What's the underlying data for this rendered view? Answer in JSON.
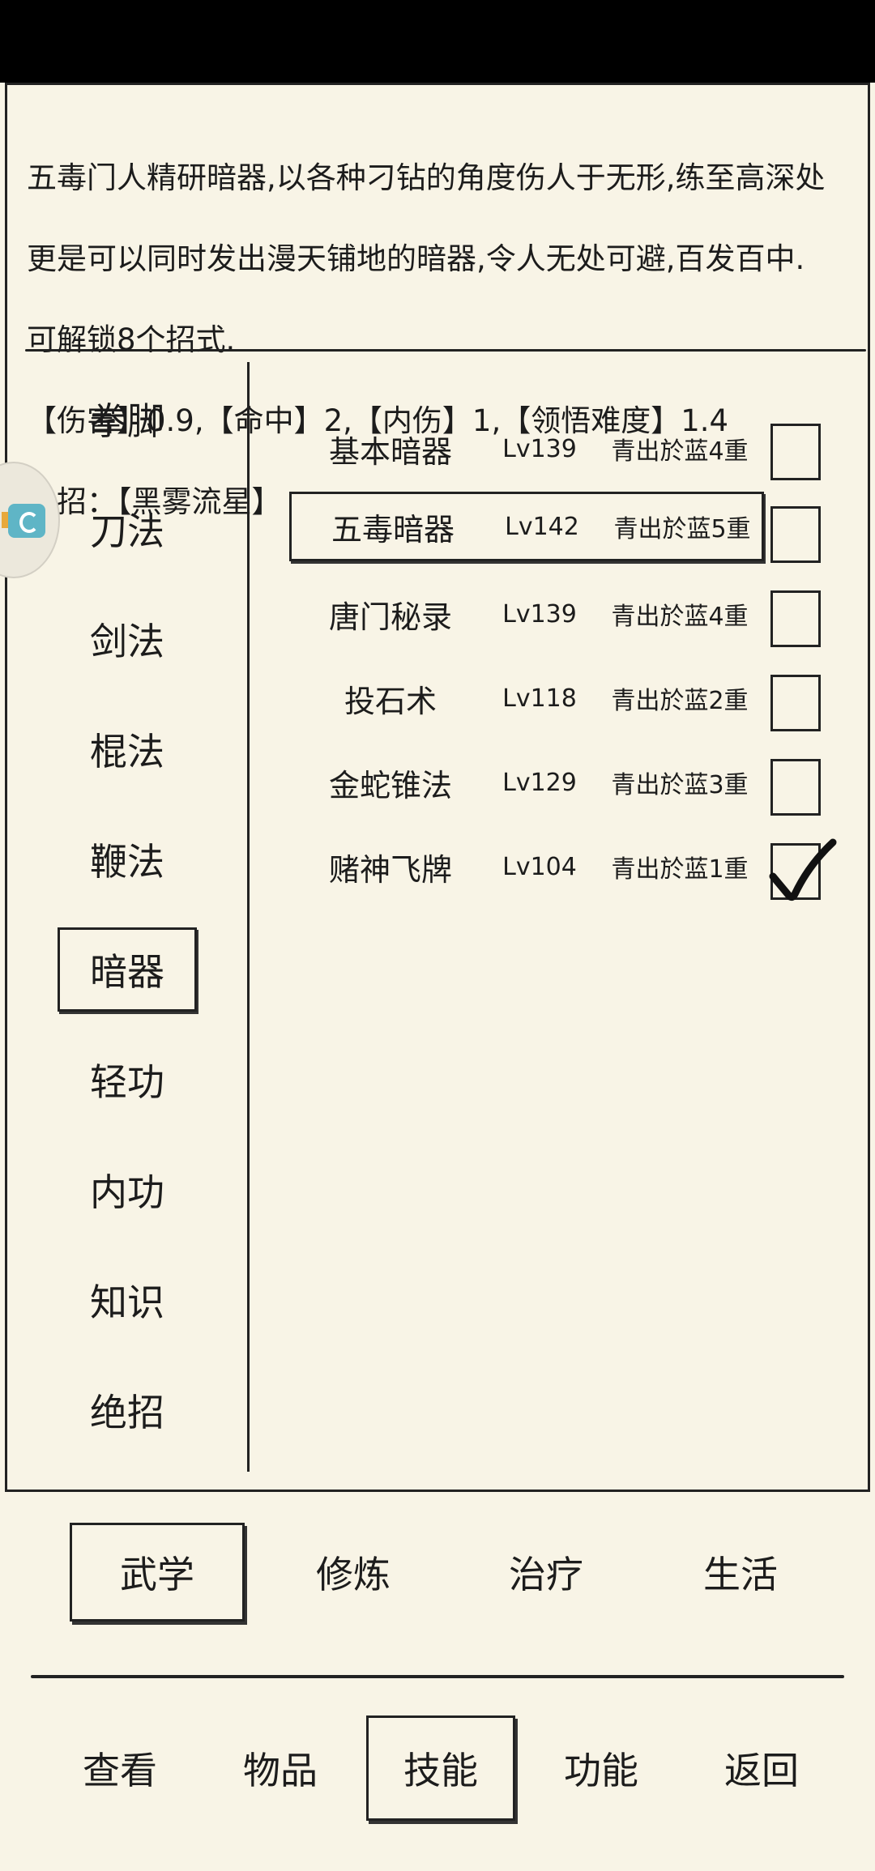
{
  "description": {
    "lines": [
      "五毒门人精研暗器,以各种刁钻的角度伤人于无形,练至高深处",
      "更是可以同时发出漫天铺地的暗器,令人无处可避,百发百中.",
      "可解锁8个招式.",
      "【伤害】0.9,【命中】2,【内伤】1,【领悟难度】1.4",
      "绝招：【黑雾流星】"
    ]
  },
  "categories": [
    {
      "label": "拳脚",
      "selected": false
    },
    {
      "label": "刀法",
      "selected": false
    },
    {
      "label": "剑法",
      "selected": false
    },
    {
      "label": "棍法",
      "selected": false
    },
    {
      "label": "鞭法",
      "selected": false
    },
    {
      "label": "暗器",
      "selected": true
    },
    {
      "label": "轻功",
      "selected": false
    },
    {
      "label": "内功",
      "selected": false
    },
    {
      "label": "知识",
      "selected": false
    },
    {
      "label": "绝招",
      "selected": false
    }
  ],
  "skills": [
    {
      "name": "基本暗器",
      "level": "Lv139",
      "rank": "青出於蓝4重",
      "checked": false,
      "selected": false
    },
    {
      "name": "五毒暗器",
      "level": "Lv142",
      "rank": "青出於蓝5重",
      "checked": false,
      "selected": true
    },
    {
      "name": "唐门秘录",
      "level": "Lv139",
      "rank": "青出於蓝4重",
      "checked": false,
      "selected": false
    },
    {
      "name": "投石术",
      "level": "Lv118",
      "rank": "青出於蓝2重",
      "checked": false,
      "selected": false
    },
    {
      "name": "金蛇锥法",
      "level": "Lv129",
      "rank": "青出於蓝3重",
      "checked": false,
      "selected": false
    },
    {
      "name": "赌神飞牌",
      "level": "Lv104",
      "rank": "青出於蓝1重",
      "checked": true,
      "selected": false
    }
  ],
  "sub_tabs": [
    {
      "label": "武学",
      "selected": true
    },
    {
      "label": "修炼",
      "selected": false
    },
    {
      "label": "治疗",
      "selected": false
    },
    {
      "label": "生活",
      "selected": false
    }
  ],
  "nav_tabs": [
    {
      "label": "查看",
      "selected": false
    },
    {
      "label": "物品",
      "selected": false
    },
    {
      "label": "技能",
      "selected": true
    },
    {
      "label": "功能",
      "selected": false
    },
    {
      "label": "返回",
      "selected": false
    }
  ],
  "icons": {
    "checkmark": "checkmark-icon",
    "floating_assistant": "floating-assistant-icon"
  },
  "colors": {
    "background": "#f8f4e6",
    "ink": "#1c1c1c",
    "status_bar": "#000000"
  }
}
